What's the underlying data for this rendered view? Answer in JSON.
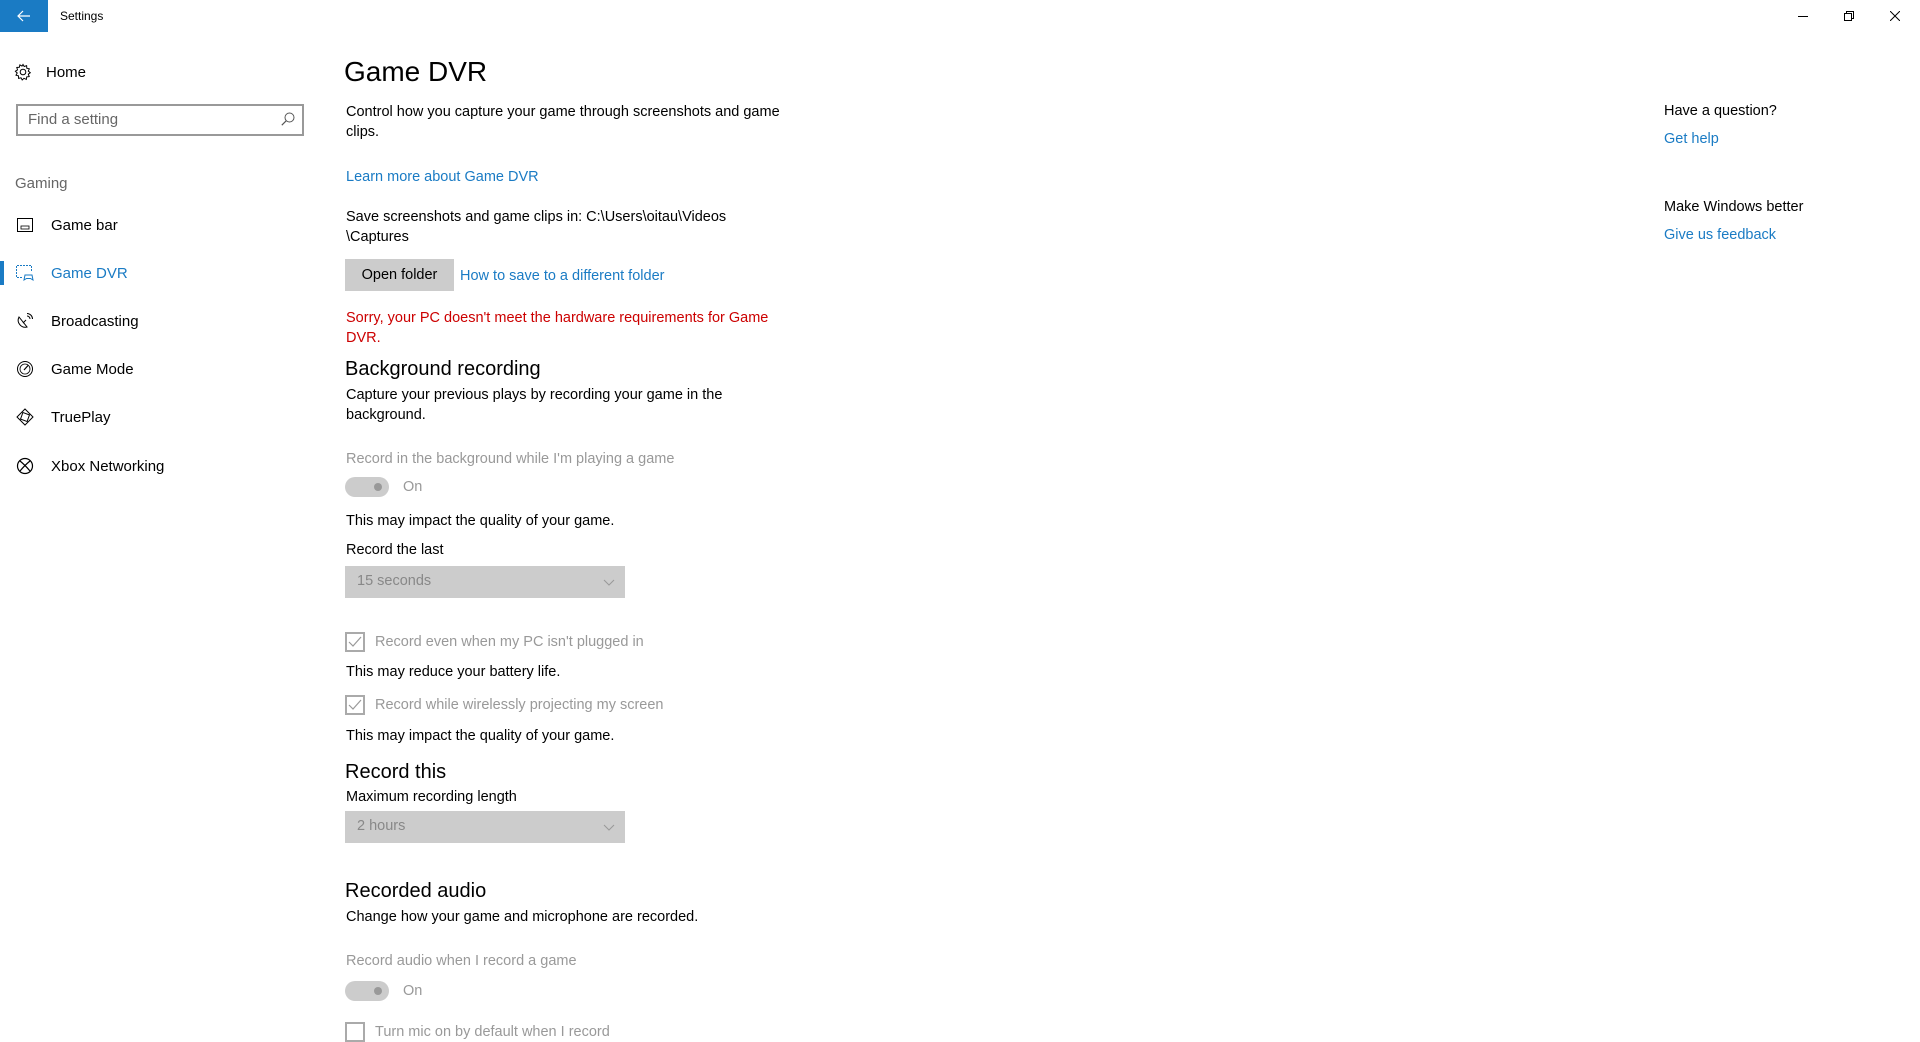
{
  "window": {
    "title": "Settings",
    "controls": [
      "minimize",
      "restore",
      "close"
    ]
  },
  "sidebar": {
    "home_label": "Home",
    "search_placeholder": "Find a setting",
    "group_label": "Gaming",
    "items": [
      {
        "label": "Game bar",
        "icon": "game-bar-icon",
        "active": false
      },
      {
        "label": "Game DVR",
        "icon": "game-dvr-icon",
        "active": true
      },
      {
        "label": "Broadcasting",
        "icon": "broadcasting-icon",
        "active": false
      },
      {
        "label": "Game Mode",
        "icon": "game-mode-icon",
        "active": false
      },
      {
        "label": "TruePlay",
        "icon": "trueplay-icon",
        "active": false
      },
      {
        "label": "Xbox Networking",
        "icon": "xbox-icon",
        "active": false
      }
    ]
  },
  "main": {
    "title": "Game DVR",
    "description": "Control how you capture your game through screenshots and game clips.",
    "learn_more_link": "Learn more about Game DVR",
    "save_location_line1": "Save screenshots and game clips in: C:\\Users\\oitau\\Videos",
    "save_location_line2": "\\Captures",
    "open_folder_button": "Open folder",
    "different_folder_link": "How to save to a different folder",
    "error_message": "Sorry, your PC doesn't meet the hardware requirements for Game DVR.",
    "background_recording": {
      "heading": "Background recording",
      "description": "Capture your previous plays by recording your game in the background.",
      "toggle_label": "Record in the background while I'm playing a game",
      "toggle_state": "On",
      "toggle_note": "This may impact the quality of your game.",
      "record_last_label": "Record the last",
      "record_last_value": "15 seconds",
      "checkbox_unplugged_label": "Record even when my PC isn't plugged in",
      "checkbox_unplugged_checked": true,
      "battery_note": "This may reduce your battery life.",
      "checkbox_projecting_label": "Record while wirelessly projecting my screen",
      "checkbox_projecting_checked": true,
      "projecting_note": "This may impact the quality of your game."
    },
    "record_this": {
      "heading": "Record this",
      "max_length_label": "Maximum recording length",
      "max_length_value": "2 hours"
    },
    "recorded_audio": {
      "heading": "Recorded audio",
      "description": "Change how your game and microphone are recorded.",
      "toggle_label": "Record audio when I record a game",
      "toggle_state": "On",
      "mic_checkbox_label": "Turn mic on by default when I record",
      "mic_checkbox_checked": false
    }
  },
  "help": {
    "question_heading": "Have a question?",
    "get_help_link": "Get help",
    "feedback_heading": "Make Windows better",
    "feedback_link": "Give us feedback"
  },
  "colors": {
    "accent": "#1a7bc4",
    "error": "#cc0000",
    "disabled_text": "#999999",
    "control_fill": "#cccccc"
  }
}
